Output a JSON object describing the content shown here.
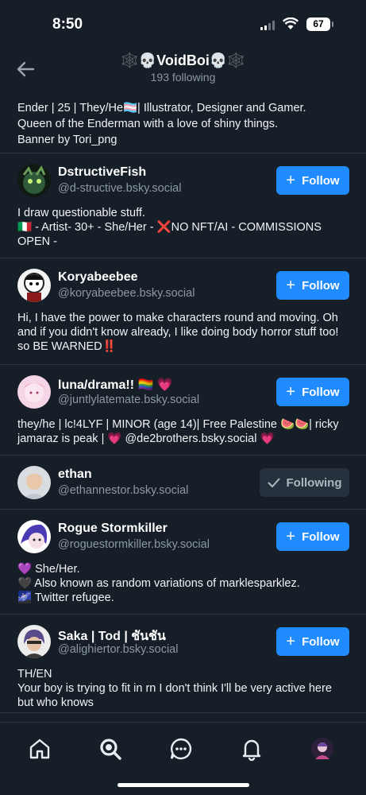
{
  "status": {
    "time": "8:50",
    "battery": "67"
  },
  "header": {
    "title": "🕸️💀VoidBoi💀🕸️",
    "subtitle": "193 following"
  },
  "top_bio": [
    "Ender | 25 | They/He🏳️‍⚧️| Illustrator, Designer and Gamer.",
    "Queen of the Enderman with a love of shiny things.",
    "Banner by Tori_png"
  ],
  "follow_label": "Follow",
  "following_label": "Following",
  "accounts": [
    {
      "name": "DstructiveFish",
      "handle": "@d-structive.bsky.social",
      "following": false,
      "bio": [
        "I draw questionable stuff.",
        "🇮🇹 - Artist- 30+ - She/Her - ❌NO NFT/AI - COMMISSIONS OPEN -"
      ]
    },
    {
      "name": "Koryabeebee",
      "handle": "@koryabeebee.bsky.social",
      "following": false,
      "bio": [
        "Hi, I have the power to make characters round and moving. Oh and if you didn't know already, I like doing body horror stuff too! so BE WARNED‼️"
      ]
    },
    {
      "name": "luna/drama!! 🏳️‍🌈 💗",
      "handle": "@juntlylatemate.bsky.social",
      "following": false,
      "bio": [
        "they/he | lc!4LYF | MINOR (age 14)| Free Palestine 🍉🍉| ricky jamaraz is peak | 💗 @de2brothers.bsky.social 💗"
      ]
    },
    {
      "name": "ethan",
      "handle": "@ethannestor.bsky.social",
      "following": true,
      "bio": []
    },
    {
      "name": "Rogue Stormkiller",
      "handle": "@roguestormkiller.bsky.social",
      "following": false,
      "bio": [
        "💜 She/Her.",
        "🖤 Also known as random variations of marklesparklez.",
        "🌌 Twitter refugee."
      ]
    },
    {
      "name": "Saka | Tod | ชันชัน",
      "handle": "@alighiertor.bsky.social",
      "following": false,
      "bio": [
        "TH/EN",
        "Your boy is trying to fit in rn I don't think I'll be very active here but who knows"
      ]
    }
  ],
  "tabs": [
    "home-icon",
    "search-icon",
    "chat-icon",
    "bell-icon",
    "profile-avatar"
  ]
}
